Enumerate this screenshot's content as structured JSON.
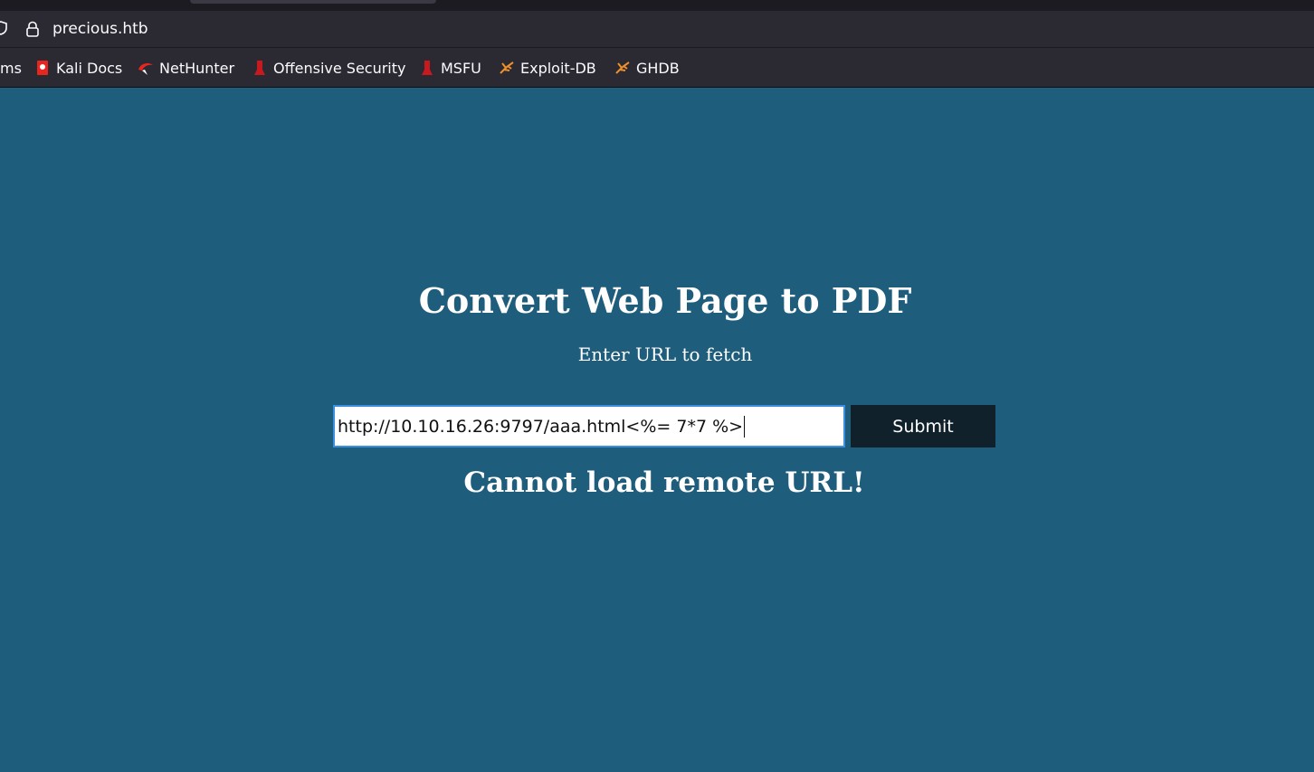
{
  "browser": {
    "url": "precious.htb",
    "bookmarks": [
      {
        "label": "ms",
        "icon": "none"
      },
      {
        "label": "Kali Docs",
        "icon": "kali-docs-icon"
      },
      {
        "label": "NetHunter",
        "icon": "nethunter-icon"
      },
      {
        "label": "Offensive Security",
        "icon": "offensive-security-icon"
      },
      {
        "label": "MSFU",
        "icon": "msfu-icon"
      },
      {
        "label": "Exploit-DB",
        "icon": "exploit-db-icon"
      },
      {
        "label": "GHDB",
        "icon": "ghdb-icon"
      }
    ]
  },
  "page": {
    "title": "Convert Web Page to PDF",
    "subtitle": "Enter URL to fetch",
    "url_value": "http://10.10.16.26:9797/aaa.html<%= 7*7 %>",
    "submit_label": "Submit",
    "error_message": "Cannot load remote URL!"
  },
  "colors": {
    "background": "#1f5d7c",
    "button": "#10212c",
    "input_focus_border": "#3a8fe0"
  }
}
